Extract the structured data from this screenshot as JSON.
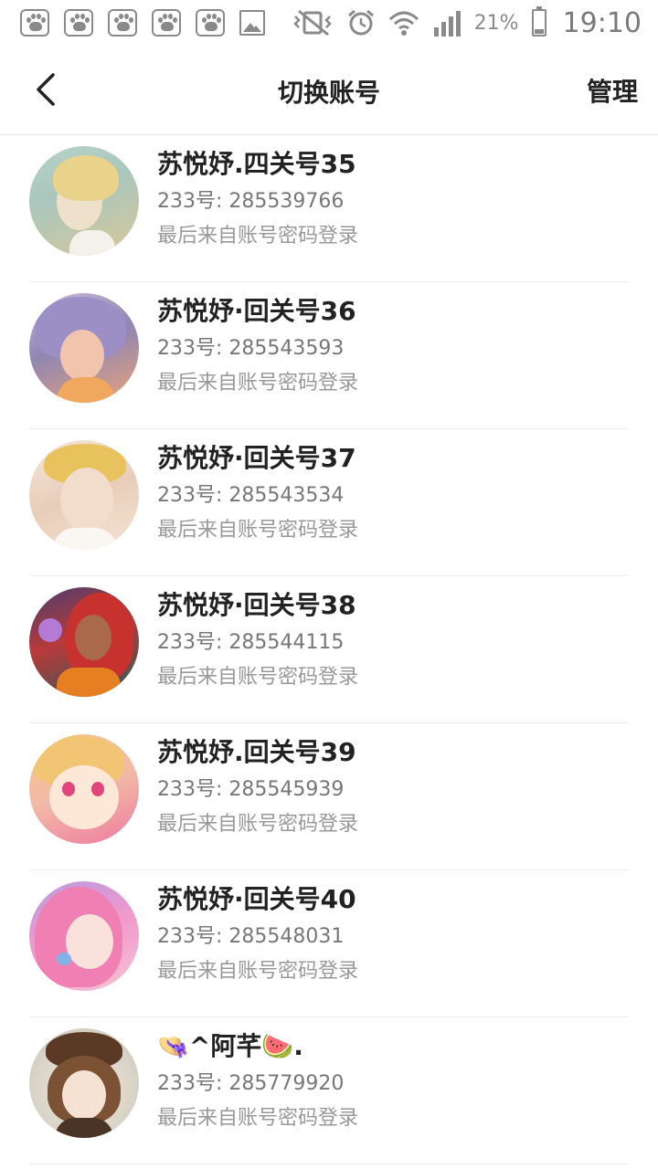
{
  "status_bar": {
    "notification_icons": [
      "baidu-paw-icon",
      "baidu-paw-icon",
      "baidu-paw-icon",
      "baidu-paw-icon",
      "baidu-paw-icon",
      "gallery-icon"
    ],
    "battery_percent": "21%",
    "battery_level": 0.21,
    "time": "19:10"
  },
  "header": {
    "title": "切换账号",
    "manage_label": "管理"
  },
  "accounts": [
    {
      "name": "苏悦妤.四关号35",
      "uid": "233号: 285539766",
      "method": "最后来自账号密码登录"
    },
    {
      "name": "苏悦妤·回关号36",
      "uid": "233号: 285543593",
      "method": "最后来自账号密码登录"
    },
    {
      "name": "苏悦妤·回关号37",
      "uid": "233号: 285543534",
      "method": "最后来自账号密码登录"
    },
    {
      "name": "苏悦妤·回关号38",
      "uid": "233号: 285544115",
      "method": "最后来自账号密码登录"
    },
    {
      "name": "苏悦妤.回关号39",
      "uid": "233号: 285545939",
      "method": "最后来自账号密码登录"
    },
    {
      "name": "苏悦妤·回关号40",
      "uid": "233号: 285548031",
      "method": "最后来自账号密码登录"
    },
    {
      "name": "👒^阿芊🍉.",
      "uid": "233号: 285779920",
      "method": "最后来自账号密码登录"
    }
  ],
  "colors": {
    "background": "#ffffff",
    "text_primary": "#222222",
    "text_secondary": "#777777",
    "text_tertiary": "#999999",
    "divider": "#ececec"
  }
}
